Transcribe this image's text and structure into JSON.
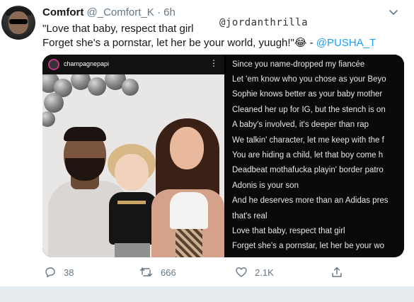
{
  "tweet": {
    "display_name": "Comfort",
    "handle": "@_Comfort_K",
    "separator": "·",
    "time": "6h",
    "text_line1": "\"Love that baby, respect that girl",
    "text_line2": "Forget she's a pornstar, let her be your world, yuugh!\"",
    "emoji": "😂",
    "text_sep": " - ",
    "mention": "@PUSHA_T",
    "watermark": "@jordanthrilla"
  },
  "media": {
    "instagram_user": "champagnepapi",
    "menu_glyph": "⋮",
    "lyrics": [
      "Since you name-dropped my fiancée",
      "Let 'em know who you chose as your Beyo",
      "Sophie knows better as your baby mother",
      "Cleaned her up for IG, but the stench is on",
      "A baby's involved, it's deeper than rap",
      "We talkin' character, let me keep with the f",
      "You are hiding a child, let that boy come h",
      "Deadbeat mothafucka playin' border patro",
      "Adonis is your son",
      "And he deserves more than an Adidas pres",
      "that's real",
      "Love that baby, respect that girl",
      "Forget she's a pornstar, let her be your wo"
    ]
  },
  "actions": {
    "reply_count": "38",
    "retweet_count": "666",
    "like_count": "2.1K"
  },
  "colors": {
    "accent": "#1da1f2",
    "muted": "#657786",
    "divider": "#e6ecf0"
  },
  "icons": [
    "chevron-down-icon",
    "reply-icon",
    "retweet-icon",
    "like-icon",
    "share-icon"
  ]
}
